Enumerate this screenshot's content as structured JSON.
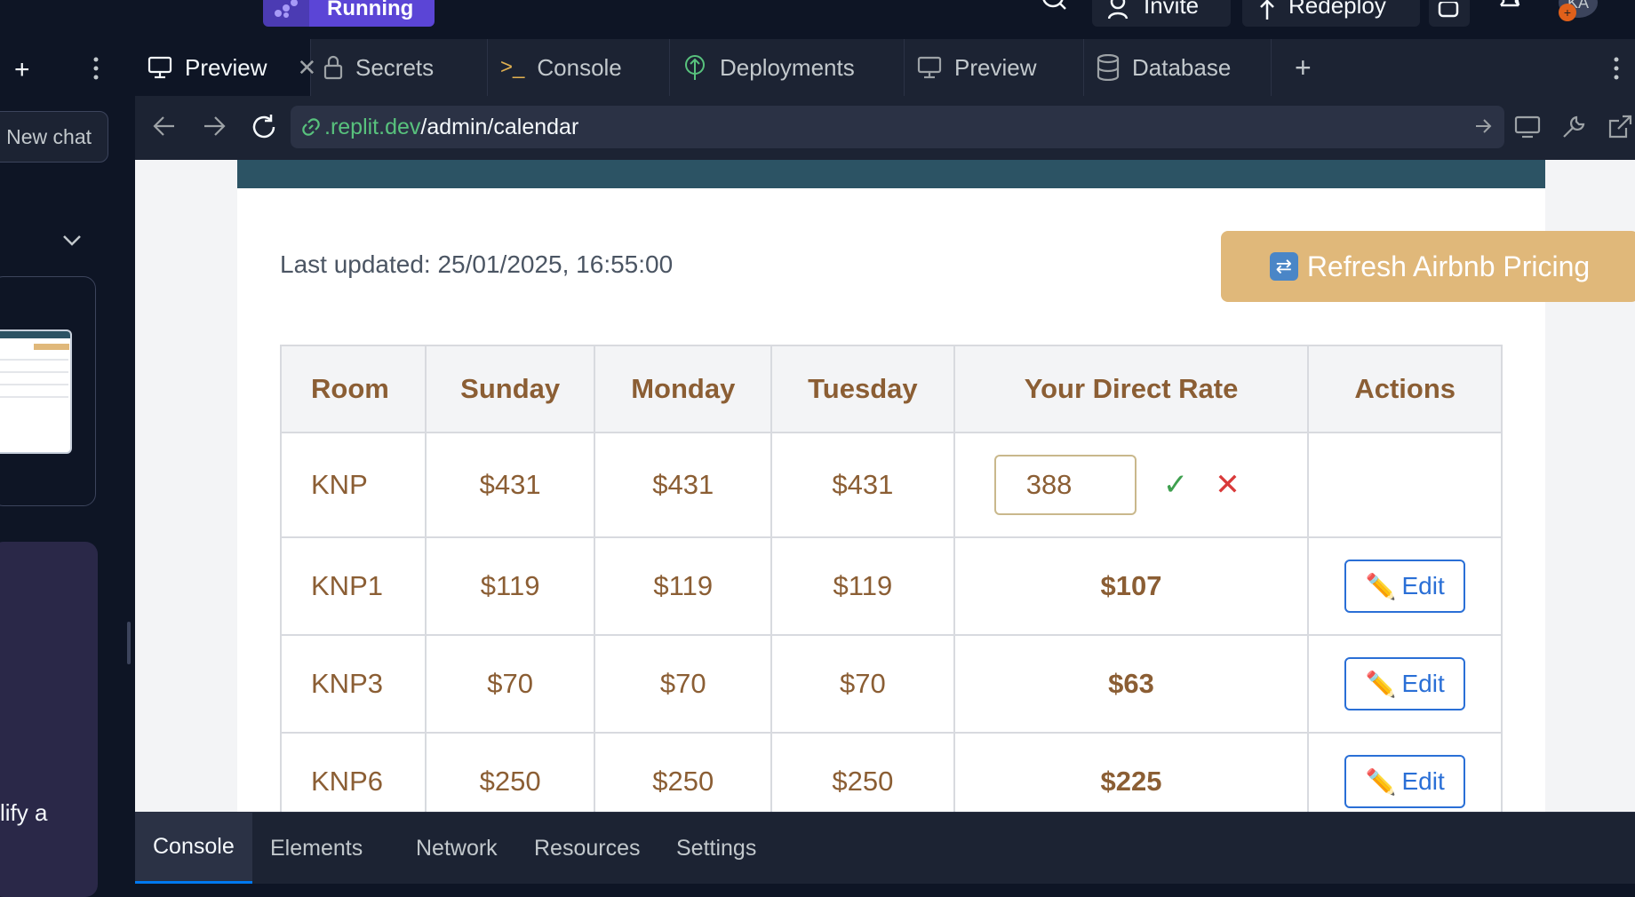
{
  "topbar": {
    "run_label": "Running",
    "invite_label": "Invite",
    "redeploy_label": "Redeploy",
    "avatar_initials": "KA"
  },
  "sidebar": {
    "new_chat_label": "New chat",
    "promo_text": "lify a"
  },
  "tabs": [
    {
      "label": "Preview",
      "icon": "monitor-icon"
    },
    {
      "label": "Secrets",
      "icon": "lock-icon"
    },
    {
      "label": "Console",
      "icon": "terminal-icon"
    },
    {
      "label": "Deployments",
      "icon": "deploy-icon"
    },
    {
      "label": "Preview",
      "icon": "monitor-icon"
    },
    {
      "label": "Database",
      "icon": "database-icon"
    }
  ],
  "urlbar": {
    "domain": ".replit.dev",
    "path": "/admin/calendar"
  },
  "page": {
    "last_updated": "Last updated: 25/01/2025, 16:55:00",
    "refresh_label": "Refresh Airbnb Pricing",
    "table": {
      "headers": [
        "Room",
        "Sunday",
        "Monday",
        "Tuesday",
        "Your Direct Rate",
        "Actions"
      ],
      "rows": [
        {
          "room": "KNP",
          "sun": "$431",
          "mon": "$431",
          "tue": "$431",
          "direct": "388",
          "editing": true
        },
        {
          "room": "KNP1",
          "sun": "$119",
          "mon": "$119",
          "tue": "$119",
          "direct": "$107",
          "action": "Edit"
        },
        {
          "room": "KNP3",
          "sun": "$70",
          "mon": "$70",
          "tue": "$70",
          "direct": "$63",
          "action": "Edit"
        },
        {
          "room": "KNP6",
          "sun": "$250",
          "mon": "$250",
          "tue": "$250",
          "direct": "$225",
          "action": "Edit"
        }
      ]
    }
  },
  "devtools": {
    "tabs": [
      "Console",
      "Elements",
      "Network",
      "Resources",
      "Settings"
    ]
  },
  "colors": {
    "accent": "#5b45d6",
    "header_band": "#2c5364",
    "refresh_button": "#e0b87a",
    "table_text": "#8b5e34",
    "direct_rate": "#3fa04f",
    "edit_button": "#2a6fd6"
  }
}
